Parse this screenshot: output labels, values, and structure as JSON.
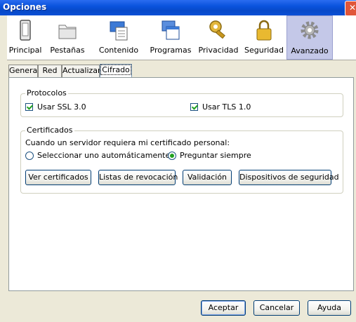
{
  "window": {
    "title": "Opciones",
    "close_glyph": "✕"
  },
  "toolbar": {
    "items": [
      {
        "label": "Principal",
        "icon": "device-icon"
      },
      {
        "label": "Pestañas",
        "icon": "folder-icon"
      },
      {
        "label": "Contenido",
        "icon": "content-icon"
      },
      {
        "label": "Programas",
        "icon": "programs-icon"
      },
      {
        "label": "Privacidad",
        "icon": "key-icon"
      },
      {
        "label": "Seguridad",
        "icon": "padlock-icon"
      },
      {
        "label": "Avanzado",
        "icon": "gear-icon",
        "selected": true
      }
    ]
  },
  "tabs": [
    {
      "label": "General"
    },
    {
      "label": "Red"
    },
    {
      "label": "Actualizar"
    },
    {
      "label": "Cifrado",
      "active": true
    }
  ],
  "protocolos": {
    "legend": "Protocolos",
    "ssl_label": "Usar SSL 3.0",
    "ssl_checked": true,
    "tls_label": "Usar TLS 1.0",
    "tls_checked": true
  },
  "certificados": {
    "legend": "Certificados",
    "prompt": "Cuando un servidor requiera mi certificado personal:",
    "option_auto": "Seleccionar uno automáticamente",
    "option_ask": "Preguntar siempre",
    "selected_option": "Preguntar siempre",
    "buttons": {
      "view": "Ver certificados",
      "revocation": "Listas de revocación",
      "validation": "Validación",
      "devices": "Dispositivos de seguridad"
    }
  },
  "footer": {
    "accept": "Aceptar",
    "cancel": "Cancelar",
    "help": "Ayuda"
  },
  "colors": {
    "titlebar": "#0a53dd",
    "selected_tab": "#c4c8e8",
    "check": "#21a121"
  }
}
